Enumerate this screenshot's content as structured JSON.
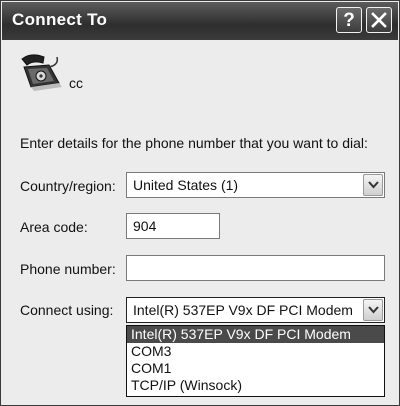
{
  "window": {
    "title": "Connect To",
    "help_label": "?",
    "close_label": "close"
  },
  "connection": {
    "name": "cc",
    "icon": "telephone-icon"
  },
  "instruction": "Enter details for the phone number that you want to dial:",
  "form": {
    "country_label": "Country/region:",
    "country_value": "United States (1)",
    "area_code_label": "Area code:",
    "area_code_value": "904",
    "phone_label": "Phone number:",
    "phone_value": "",
    "connect_using_label": "Connect using:",
    "connect_using_value": "Intel(R) 537EP V9x DF PCI Modem"
  },
  "connect_using_options": [
    "Intel(R) 537EP V9x DF PCI Modem",
    "COM3",
    "COM1",
    "TCP/IP (Winsock)"
  ],
  "colors": {
    "titlebar": "#3a3a3a",
    "selection": "#4a4a4a"
  }
}
